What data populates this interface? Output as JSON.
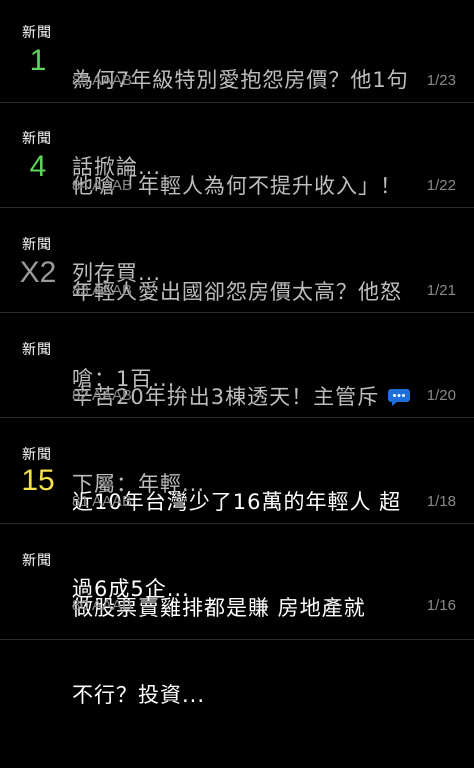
{
  "colors": {
    "background": "#000000",
    "push_1": "#5fd45f",
    "push_4": "#5fd45f",
    "push_x2": "#9a9a9a",
    "push_15": "#f4e04d",
    "comment_icon": "#1e6fd9"
  },
  "posts": [
    {
      "category": "新聞",
      "push": "1",
      "title_line1": "為何7年級特別愛抱怨房價？他1句",
      "title_line2": "話掀論...",
      "count": "85",
      "author": "AAAB",
      "date": "1/23"
    },
    {
      "category": "新聞",
      "push": "4",
      "title_line1": "他嗆「年輕人為何不提升收入」！",
      "title_line2": "列存買...",
      "count": "84",
      "author": "AAAB",
      "date": "1/22"
    },
    {
      "category": "新聞",
      "push": "X2",
      "title_line1": "年輕人愛出國卻怨房價太高？他怒",
      "title_line2": "嗆：1百...",
      "count": "83",
      "author": "AAAB",
      "date": "1/21"
    },
    {
      "category": "新聞",
      "push": "",
      "title_line1": "辛苦20年拚出3棟透天！主管斥",
      "title_line2": "下屬：年輕...",
      "count": "82",
      "author": "AAAB",
      "date": "1/20",
      "icon": "comment-bubble-icon"
    },
    {
      "category": "新聞",
      "push": "15",
      "title_line1": "近10年台灣少了16萬的年輕人 超",
      "title_line2": "過6成5企...",
      "count": "81",
      "author": "AAAB",
      "date": "1/18"
    },
    {
      "category": "新聞",
      "push": "",
      "title_line1": "做股票賣雞排都是賺 房地產就",
      "title_line2": "不行？投資...",
      "count": "80",
      "author": "AAAB",
      "date": "1/16"
    }
  ]
}
